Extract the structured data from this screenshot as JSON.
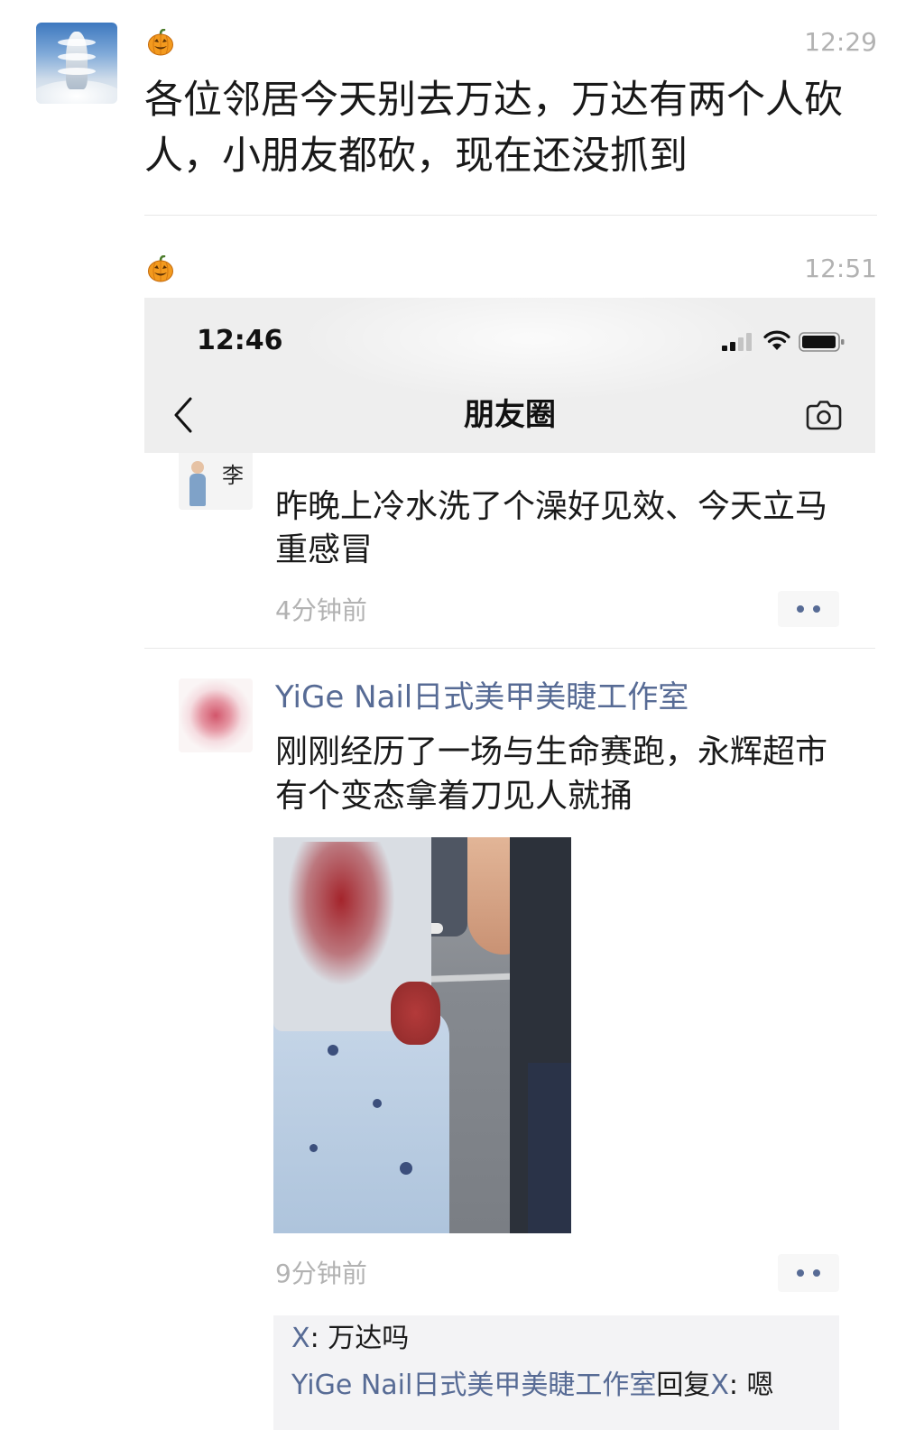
{
  "colors": {
    "link_blue": "#576b95",
    "time_gray": "#b2b2b2",
    "header_bg": "#eeeeee",
    "comment_bg": "#f3f3f5",
    "text": "#191919"
  },
  "chat": {
    "messages": [
      {
        "icon": "pumpkin-icon",
        "time": "12:29",
        "text": "各位邻居今天别去万达，万达有两个人砍人，小朋友都砍，现在还没抓到"
      },
      {
        "icon": "pumpkin-icon",
        "time": "12:51",
        "attachment": "moments-screenshot"
      }
    ]
  },
  "moments": {
    "status_bar": {
      "time": "12:46",
      "icons": [
        "signal-icon",
        "wifi-icon",
        "battery-icon"
      ]
    },
    "nav": {
      "back_icon": "back-chevron-icon",
      "title": "朋友圈",
      "camera_icon": "camera-icon"
    },
    "posts": [
      {
        "avatar_text": "李",
        "text": "昨晚上冷水洗了个澡好见效、今天立马重感冒",
        "time_ago": "4分钟前",
        "more_icon": "more-dots-icon"
      },
      {
        "author": "YiGe Nail日式美甲美睫工作室",
        "text": "刚刚经历了一场与生命赛跑，永辉超市有个变态拿着刀见人就捅",
        "time_ago": "9分钟前",
        "more_icon": "more-dots-icon",
        "comments": [
          {
            "author": "X",
            "separator": ": ",
            "text": "万达吗"
          },
          {
            "author": "YiGe Nail日式美甲美睫工作室",
            "reply_label": "回复",
            "reply_to": "X",
            "separator": ": ",
            "text": "嗯"
          }
        ]
      }
    ]
  }
}
